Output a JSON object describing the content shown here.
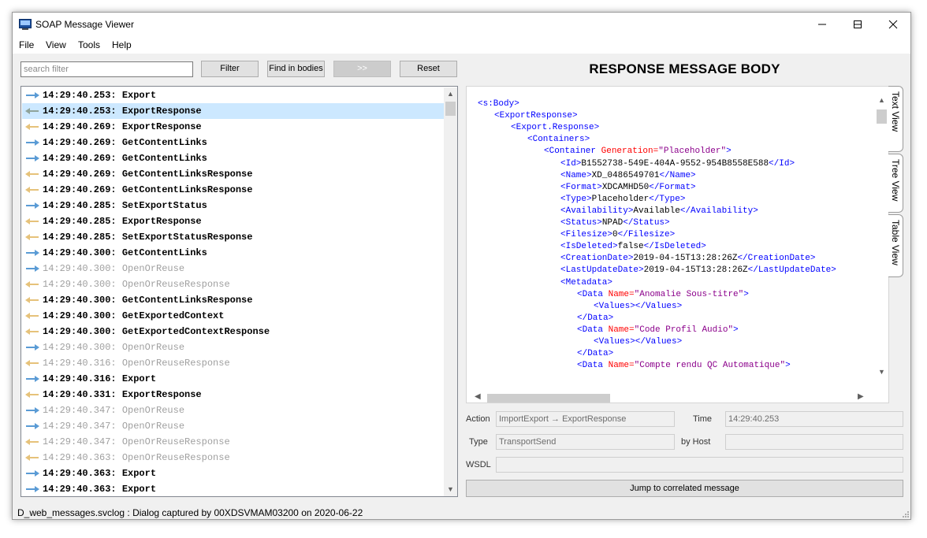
{
  "window": {
    "title": "SOAP Message Viewer",
    "controls": {
      "minimize": "minimize-icon",
      "maximize": "maximize-icon",
      "close": "close-icon"
    }
  },
  "menu": [
    "File",
    "View",
    "Tools",
    "Help"
  ],
  "toolbar": {
    "search_placeholder": "search filter",
    "filter": "Filter",
    "find_in_bodies": "Find in bodies",
    "next": ">>",
    "reset": "Reset"
  },
  "messages": [
    {
      "time": "14:29:40.253",
      "name": "Export",
      "dir": "out",
      "dim": false,
      "selected": false
    },
    {
      "time": "14:29:40.253",
      "name": "ExportResponse",
      "dir": "in",
      "dim": false,
      "selected": true
    },
    {
      "time": "14:29:40.269",
      "name": "ExportResponse",
      "dir": "in",
      "dim": false,
      "selected": false
    },
    {
      "time": "14:29:40.269",
      "name": "GetContentLinks",
      "dir": "out",
      "dim": false,
      "selected": false
    },
    {
      "time": "14:29:40.269",
      "name": "GetContentLinks",
      "dir": "out",
      "dim": false,
      "selected": false
    },
    {
      "time": "14:29:40.269",
      "name": "GetContentLinksResponse",
      "dir": "in",
      "dim": false,
      "selected": false
    },
    {
      "time": "14:29:40.269",
      "name": "GetContentLinksResponse",
      "dir": "in",
      "dim": false,
      "selected": false
    },
    {
      "time": "14:29:40.285",
      "name": "SetExportStatus",
      "dir": "out",
      "dim": false,
      "selected": false
    },
    {
      "time": "14:29:40.285",
      "name": "ExportResponse",
      "dir": "in",
      "dim": false,
      "selected": false
    },
    {
      "time": "14:29:40.285",
      "name": "SetExportStatusResponse",
      "dir": "in",
      "dim": false,
      "selected": false
    },
    {
      "time": "14:29:40.300",
      "name": "GetContentLinks",
      "dir": "out",
      "dim": false,
      "selected": false
    },
    {
      "time": "14:29:40.300",
      "name": "OpenOrReuse",
      "dir": "out",
      "dim": true,
      "selected": false
    },
    {
      "time": "14:29:40.300",
      "name": "OpenOrReuseResponse",
      "dir": "in",
      "dim": true,
      "selected": false
    },
    {
      "time": "14:29:40.300",
      "name": "GetContentLinksResponse",
      "dir": "in",
      "dim": false,
      "selected": false
    },
    {
      "time": "14:29:40.300",
      "name": "GetExportedContext",
      "dir": "in",
      "dim": false,
      "selected": false
    },
    {
      "time": "14:29:40.300",
      "name": "GetExportedContextResponse",
      "dir": "in",
      "dim": false,
      "selected": false
    },
    {
      "time": "14:29:40.300",
      "name": "OpenOrReuse",
      "dir": "out",
      "dim": true,
      "selected": false
    },
    {
      "time": "14:29:40.316",
      "name": "OpenOrReuseResponse",
      "dir": "in",
      "dim": true,
      "selected": false
    },
    {
      "time": "14:29:40.316",
      "name": "Export",
      "dir": "out",
      "dim": false,
      "selected": false
    },
    {
      "time": "14:29:40.331",
      "name": "ExportResponse",
      "dir": "in",
      "dim": false,
      "selected": false
    },
    {
      "time": "14:29:40.347",
      "name": "OpenOrReuse",
      "dir": "out",
      "dim": true,
      "selected": false
    },
    {
      "time": "14:29:40.347",
      "name": "OpenOrReuse",
      "dir": "out",
      "dim": true,
      "selected": false
    },
    {
      "time": "14:29:40.347",
      "name": "OpenOrReuseResponse",
      "dir": "in",
      "dim": true,
      "selected": false
    },
    {
      "time": "14:29:40.363",
      "name": "OpenOrReuseResponse",
      "dir": "in",
      "dim": true,
      "selected": false
    },
    {
      "time": "14:29:40.363",
      "name": "Export",
      "dir": "out",
      "dim": false,
      "selected": false
    },
    {
      "time": "14:29:40.363",
      "name": "Export",
      "dir": "out",
      "dim": false,
      "selected": false
    }
  ],
  "response_title": "RESPONSE MESSAGE BODY",
  "xml_lines": [
    {
      "indent": 0,
      "parts": [
        [
          "t",
          "<s:Body>"
        ]
      ]
    },
    {
      "indent": 1,
      "parts": [
        [
          "t",
          "<ExportResponse>"
        ]
      ]
    },
    {
      "indent": 2,
      "parts": [
        [
          "t",
          "<Export.Response>"
        ]
      ]
    },
    {
      "indent": 3,
      "parts": [
        [
          "t",
          "<Containers>"
        ]
      ]
    },
    {
      "indent": 4,
      "parts": [
        [
          "t",
          "<Container "
        ],
        [
          "a",
          "Generation="
        ],
        [
          "v",
          "\"Placeholder\""
        ],
        [
          "t",
          ">"
        ]
      ]
    },
    {
      "indent": 5,
      "parts": [
        [
          "t",
          "<Id>"
        ],
        [
          "x",
          "B1552738-549E-404A-9552-954B8558E588"
        ],
        [
          "t",
          "</Id>"
        ]
      ]
    },
    {
      "indent": 5,
      "parts": [
        [
          "t",
          "<Name>"
        ],
        [
          "x",
          "XD_0486549701"
        ],
        [
          "t",
          "</Name>"
        ]
      ]
    },
    {
      "indent": 5,
      "parts": [
        [
          "t",
          "<Format>"
        ],
        [
          "x",
          "XDCAMHD50"
        ],
        [
          "t",
          "</Format>"
        ]
      ]
    },
    {
      "indent": 5,
      "parts": [
        [
          "t",
          "<Type>"
        ],
        [
          "x",
          "Placeholder"
        ],
        [
          "t",
          "</Type>"
        ]
      ]
    },
    {
      "indent": 5,
      "parts": [
        [
          "t",
          "<Availability>"
        ],
        [
          "x",
          "Available"
        ],
        [
          "t",
          "</Availability>"
        ]
      ]
    },
    {
      "indent": 5,
      "parts": [
        [
          "t",
          "<Status>"
        ],
        [
          "x",
          "NPAD"
        ],
        [
          "t",
          "</Status>"
        ]
      ]
    },
    {
      "indent": 5,
      "parts": [
        [
          "t",
          "<Filesize>"
        ],
        [
          "x",
          "0"
        ],
        [
          "t",
          "</Filesize>"
        ]
      ]
    },
    {
      "indent": 5,
      "parts": [
        [
          "t",
          "<IsDeleted>"
        ],
        [
          "x",
          "false"
        ],
        [
          "t",
          "</IsDeleted>"
        ]
      ]
    },
    {
      "indent": 5,
      "parts": [
        [
          "t",
          "<CreationDate>"
        ],
        [
          "x",
          "2019-04-15T13:28:26Z"
        ],
        [
          "t",
          "</CreationDate>"
        ]
      ]
    },
    {
      "indent": 5,
      "parts": [
        [
          "t",
          "<LastUpdateDate>"
        ],
        [
          "x",
          "2019-04-15T13:28:26Z"
        ],
        [
          "t",
          "</LastUpdateDate>"
        ]
      ]
    },
    {
      "indent": 5,
      "parts": [
        [
          "t",
          "<Metadata>"
        ]
      ]
    },
    {
      "indent": 6,
      "parts": [
        [
          "t",
          "<Data "
        ],
        [
          "a",
          "Name="
        ],
        [
          "v",
          "\"Anomalie Sous-titre\""
        ],
        [
          "t",
          ">"
        ]
      ]
    },
    {
      "indent": 7,
      "parts": [
        [
          "t",
          "<Values></Values>"
        ]
      ]
    },
    {
      "indent": 6,
      "parts": [
        [
          "t",
          "</Data>"
        ]
      ]
    },
    {
      "indent": 6,
      "parts": [
        [
          "t",
          "<Data "
        ],
        [
          "a",
          "Name="
        ],
        [
          "v",
          "\"Code Profil Audio\""
        ],
        [
          "t",
          ">"
        ]
      ]
    },
    {
      "indent": 7,
      "parts": [
        [
          "t",
          "<Values></Values>"
        ]
      ]
    },
    {
      "indent": 6,
      "parts": [
        [
          "t",
          "</Data>"
        ]
      ]
    },
    {
      "indent": 6,
      "parts": [
        [
          "t",
          "<Data "
        ],
        [
          "a",
          "Name="
        ],
        [
          "v",
          "\"Compte rendu QC Automatique\""
        ],
        [
          "t",
          ">"
        ]
      ]
    }
  ],
  "view_tabs": [
    "Text View",
    "Tree View",
    "Table View"
  ],
  "details": {
    "action_label": "Action",
    "action_value": "ImportExport → ExportResponse",
    "time_label": "Time",
    "time_value": "14:29:40.253",
    "type_label": "Type",
    "type_value": "TransportSend",
    "host_label": "by Host",
    "host_value": "",
    "wsdl_label": "WSDL",
    "wsdl_value": "",
    "jump_button": "Jump to correlated message"
  },
  "status_bar": "D_web_messages.svclog : Dialog captured by 00XDSVMAM03200 on 2020-06-22",
  "colors": {
    "arrow_out": "#5a9bd5",
    "arrow_in": "#e6c27a",
    "selection": "#cce8ff",
    "xml_tag": "#0000ff",
    "xml_attr": "#ff0000",
    "xml_attr_value": "#8b008b"
  }
}
